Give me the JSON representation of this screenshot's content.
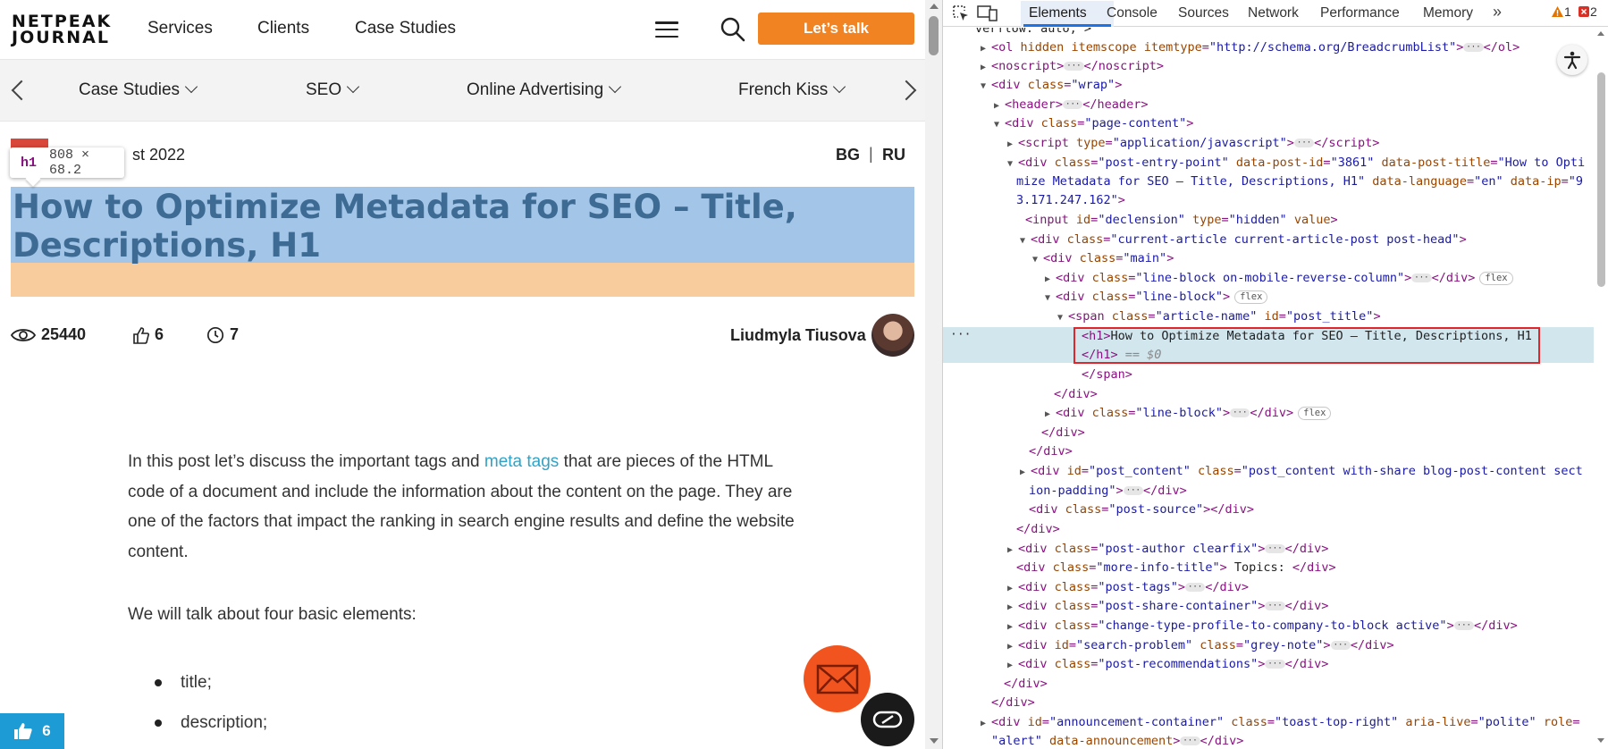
{
  "site": {
    "logo_line1": "NETPEAK",
    "logo_line2": "JOURNAL",
    "nav": [
      "Services",
      "Clients",
      "Case Studies"
    ],
    "cta": "Let’s talk",
    "categories": [
      "Case Studies",
      "SEO",
      "Online Advertising",
      "French Kiss"
    ],
    "date": "st 2022",
    "lang_bg": "BG",
    "lang_sep": "|",
    "lang_ru": "RU",
    "tooltip_tag": "h1",
    "tooltip_size": "808 × 68.2",
    "title": "How to Optimize Metadata for SEO – Title, Descriptions, H1",
    "views": "25440",
    "likes": "6",
    "comments": "7",
    "author": "Liudmyla Tiusova",
    "para1_a": "In this post let’s discuss the important tags and ",
    "para1_link": "meta tags",
    "para1_b": " that are pieces of the HTML code of a document and include the information about the content on the page. They are one of the factors that impact the ranking in search engine results and define the website content.",
    "para2": "We will talk about four basic elements:",
    "list": [
      "title;",
      "description;"
    ],
    "like_count": "6",
    "colors": {
      "accent": "#f28322",
      "link": "#2fa3c7",
      "highlight_content": "#a2c5e8",
      "highlight_margin": "#f9cc9d",
      "like_widget": "#1d9bd4",
      "mail_button": "#f2541f"
    }
  },
  "devtools": {
    "tabs": [
      "Elements",
      "Console",
      "Sources",
      "Network",
      "Performance",
      "Memory"
    ],
    "more": "»",
    "warnings": "1",
    "errors": "2",
    "selected_suffix": "== $0",
    "selected_dots": "···",
    "colors": {
      "tag": "#881280",
      "attr_name": "#994500",
      "attr_value": "#1a1aa6",
      "selection": "#d2e6ee",
      "selection_box": "#e0262a"
    }
  }
}
